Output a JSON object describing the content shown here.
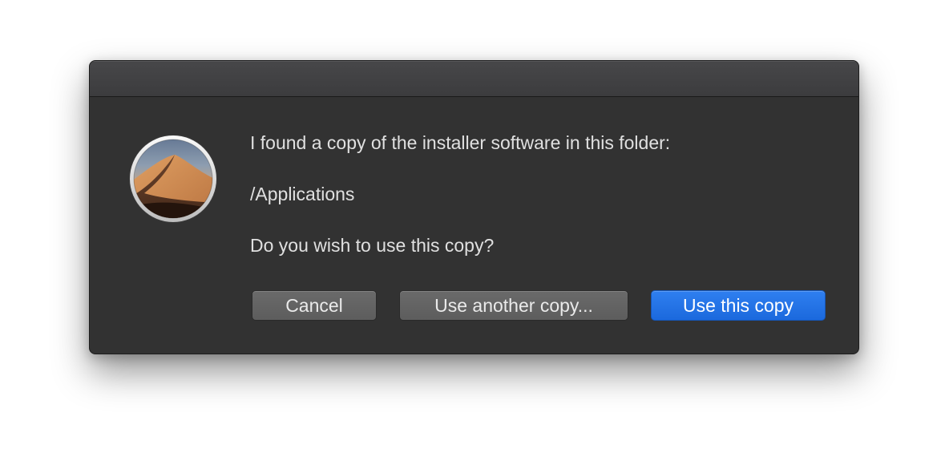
{
  "dialog": {
    "icon": "macos-mojave-installer-icon",
    "message": "I found a copy of the installer software in this folder:",
    "path": "/Applications",
    "question": "Do you wish to use this copy?",
    "buttons": {
      "cancel": "Cancel",
      "other": "Use another copy...",
      "primary": "Use this copy"
    }
  },
  "colors": {
    "dialog_background": "#323232",
    "title_bar": "#444446",
    "text": "#e0e0e0",
    "button": "#646464",
    "primary_button": "#2474e8"
  }
}
